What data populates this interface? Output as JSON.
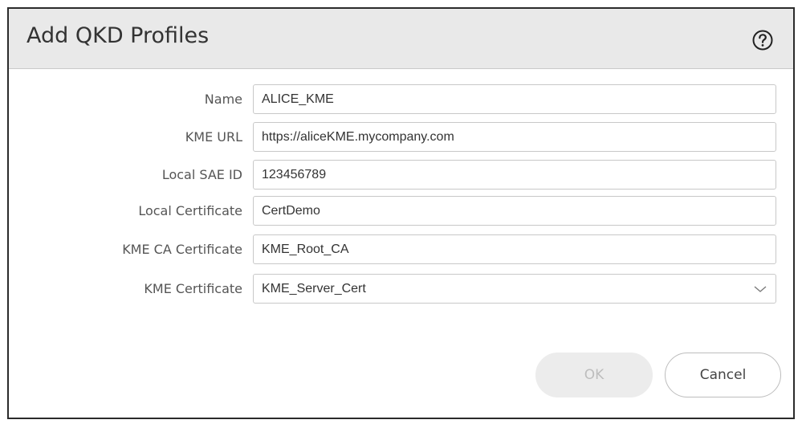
{
  "dialog": {
    "title": "Add QKD Profiles",
    "help_icon": "question-circle-icon"
  },
  "form": {
    "fields": [
      {
        "label": "Name",
        "value": "ALICE_KME"
      },
      {
        "label": "KME URL",
        "value": "https://aliceKME.mycompany.com"
      },
      {
        "label": "Local SAE ID",
        "value": "123456789"
      },
      {
        "label": "Local Certificate",
        "value": "CertDemo"
      },
      {
        "label": "KME CA Certificate",
        "value": "KME_Root_CA"
      },
      {
        "label": "KME Certificate",
        "value": "KME_Server_Cert",
        "dropdown_icon": "chevron-down-icon"
      }
    ]
  },
  "buttons": {
    "ok_label": "OK",
    "cancel_label": "Cancel"
  },
  "colors": {
    "header_bg": "#e9e9e9",
    "border": "#2b2b2b",
    "ok_disabled_bg": "#ececec"
  }
}
